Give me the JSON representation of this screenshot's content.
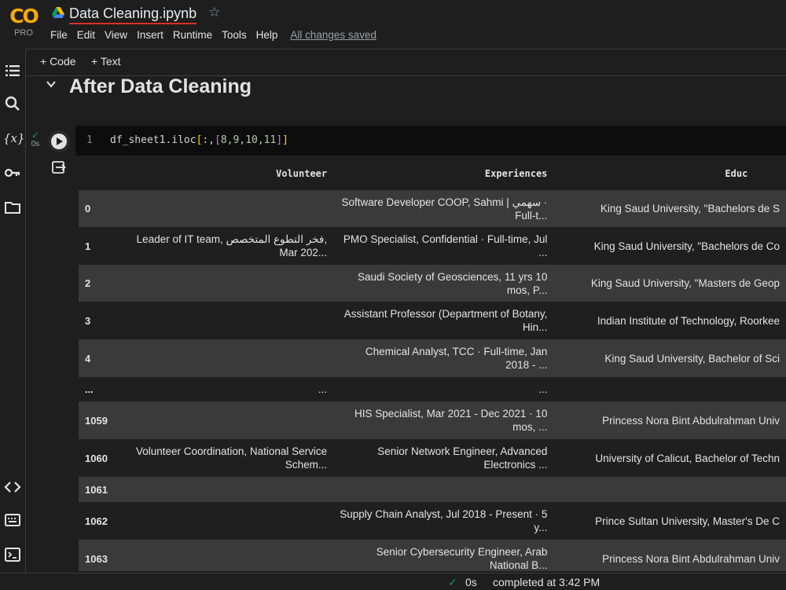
{
  "app": {
    "logo_text": "CO",
    "logo_badge": "PRO",
    "notebook_title": "Data Cleaning.ipynb",
    "star_icon": "star-icon",
    "accent_color": "#f9ab00"
  },
  "menu": [
    "File",
    "Edit",
    "View",
    "Insert",
    "Runtime",
    "Tools",
    "Help"
  ],
  "saved_status": "All changes saved",
  "toolbar": {
    "add_code": "+ Code",
    "add_text": "+ Text"
  },
  "sidebar_icons": [
    "toc-icon",
    "search-icon",
    "variables-icon",
    "secrets-key-icon",
    "files-folder-icon",
    "code-snippets-icon",
    "command-palette-icon",
    "terminal-icon"
  ],
  "section": {
    "title": "After Data Cleaning"
  },
  "cell": {
    "status_time": "0s",
    "line_number": "1",
    "code_prefix": "df_sheet1.iloc",
    "code_open": "[",
    "code_colon": ":,",
    "code_list_open": "[",
    "code_nums": "8,9,10,11",
    "code_list_close": "]",
    "code_close": "]"
  },
  "table": {
    "columns": [
      "",
      "Volunteer",
      "Experiences",
      "Educ"
    ],
    "rows": [
      {
        "idx": "0",
        "volunteer": "",
        "experiences": "Software Developer COOP, Sahmi | سهمي · Full-t...",
        "education": "King Saud University, \"Bachelors de S"
      },
      {
        "idx": "1",
        "volunteer": "Leader of IT team, فخر التطوع المتخصص, Mar 202...",
        "experiences": "PMO Specialist, Confidential · Full-time, Jul ...",
        "education": "King Saud University, \"Bachelors de Co"
      },
      {
        "idx": "2",
        "volunteer": "",
        "experiences": "Saudi Society of Geosciences, 11 yrs 10 mos, P...",
        "education": "King Saud University, \"Masters de Geop"
      },
      {
        "idx": "3",
        "volunteer": "",
        "experiences": "Assistant Professor (Department of Botany, Hin...",
        "education": "Indian Institute of Technology, Roorkee"
      },
      {
        "idx": "4",
        "volunteer": "",
        "experiences": "Chemical Analyst, TCC · Full-time, Jan 2018 - ...",
        "education": "King Saud University, Bachelor of Sci"
      },
      {
        "idx": "...",
        "volunteer": "...",
        "experiences": "...",
        "education": ""
      },
      {
        "idx": "1059",
        "volunteer": "",
        "experiences": "HIS Specialist, Mar 2021 - Dec 2021 · 10 mos, ...",
        "education": "Princess Nora Bint Abdulrahman Univ"
      },
      {
        "idx": "1060",
        "volunteer": "Volunteer Coordination, National Service Schem...",
        "experiences": "Senior Network Engineer, Advanced Electronics ...",
        "education": "University of Calicut, Bachelor of Techn"
      },
      {
        "idx": "1061",
        "volunteer": "",
        "experiences": "",
        "education": ""
      },
      {
        "idx": "1062",
        "volunteer": "",
        "experiences": "Supply Chain Analyst, Jul 2018 - Present · 5 y...",
        "education": "Prince Sultan University, Master's De C"
      },
      {
        "idx": "1063",
        "volunteer": "",
        "experiences": "Senior Cybersecurity Engineer, Arab National B...",
        "education": "Princess Nora Bint Abdulrahman Univ"
      }
    ]
  },
  "statusbar": {
    "duration": "0s",
    "message": "completed at 3:42 PM"
  }
}
